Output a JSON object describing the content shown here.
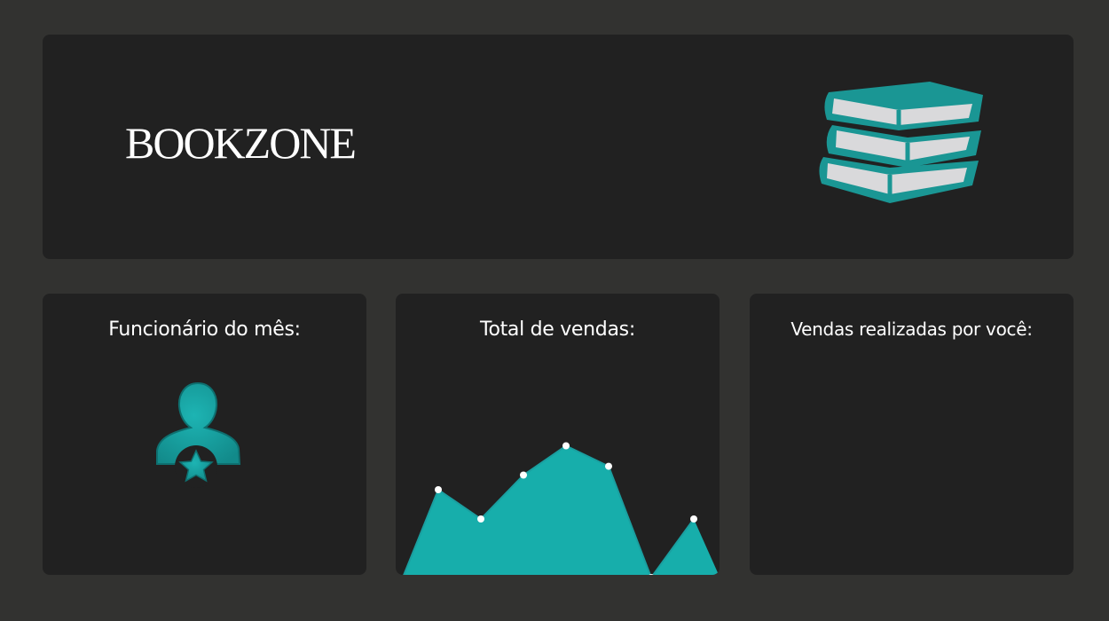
{
  "header": {
    "brand": "BOOKZONE",
    "logo_icon": "book-stack-icon"
  },
  "cards": {
    "employee": {
      "title": "Funcionário do mês:",
      "icon": "employee-star-icon"
    },
    "sales": {
      "title": "Total de vendas:"
    },
    "yours": {
      "title": "Vendas realizadas por você:"
    }
  },
  "colors": {
    "background": "#323230",
    "card": "#212121",
    "accent": "#1a9fa0",
    "accent_light": "#17aeab",
    "text": "#ffffff"
  },
  "chart_data": {
    "type": "area",
    "x": [
      0,
      1,
      2,
      3,
      4,
      5,
      6,
      7
    ],
    "values": [
      0,
      3,
      2,
      3.5,
      4.5,
      3.8,
      0,
      2
    ],
    "ylim": [
      0,
      5
    ],
    "grid": false,
    "legend": "none"
  }
}
